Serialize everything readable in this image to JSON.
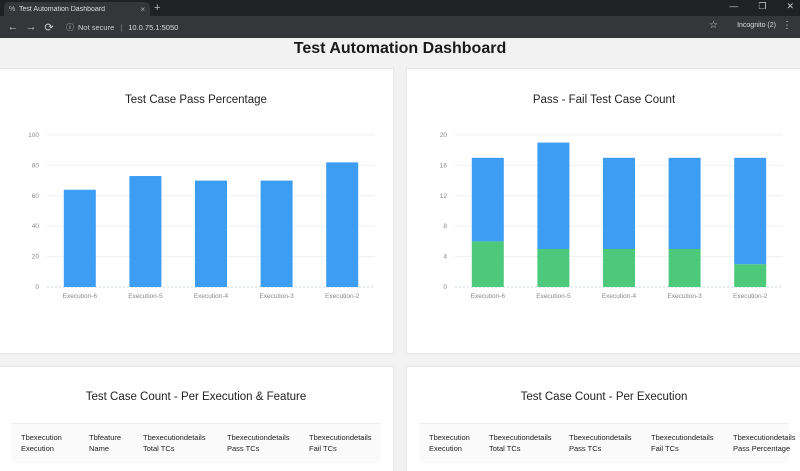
{
  "browser": {
    "tab_favicon": "%",
    "tab_title": "Test Automation Dashboard",
    "tab_close": "×",
    "new_tab": "+",
    "win_minimize": "—",
    "win_restore": "❐",
    "win_close": "✕",
    "back": "←",
    "forward": "→",
    "reload": "⟳",
    "info_icon": "ⓘ",
    "not_secure": "Not secure",
    "separator": "|",
    "url": "10.0.75.1:5050",
    "star": "☆",
    "incognito": "Incognito (2)",
    "menu": "⋮"
  },
  "page": {
    "title": "Test Automation Dashboard"
  },
  "cards": {
    "pass_percentage": {
      "title": "Test Case Pass Percentage"
    },
    "pass_fail": {
      "title": "Pass - Fail Test Case Count"
    },
    "per_execution_feature": {
      "title": "Test Case Count - Per Execution & Feature",
      "columns": [
        [
          "Tbexecution",
          "Execution"
        ],
        [
          "Tbfeature",
          "Name"
        ],
        [
          "Tbexecutiondetails",
          "Total TCs"
        ],
        [
          "Tbexecutiondetails",
          "Pass TCs"
        ],
        [
          "Tbexecutiondetails",
          "Fail TCs"
        ]
      ]
    },
    "per_execution": {
      "title": "Test Case Count - Per Execution",
      "columns": [
        [
          "Tbexecution",
          "Execution"
        ],
        [
          "Tbexecutiondetails",
          "Total TCs"
        ],
        [
          "Tbexecutiondetails",
          "Pass TCs"
        ],
        [
          "Tbexecutiondetails",
          "Fail TCs"
        ],
        [
          "Tbexecutiondetails",
          "Pass Percentage"
        ]
      ]
    }
  },
  "chart_data": [
    {
      "type": "bar",
      "title": "Test Case Pass Percentage",
      "categories": [
        "Execution-6",
        "Execution-5",
        "Execution-4",
        "Execution-3",
        "Execution-2"
      ],
      "values": [
        64,
        73,
        70,
        70,
        82
      ],
      "ylim": [
        0,
        100
      ],
      "yticks": [
        0,
        20,
        40,
        60,
        80,
        100
      ],
      "grid": true,
      "colors": [
        "#3d9df2"
      ]
    },
    {
      "type": "bar",
      "stacked": true,
      "title": "Pass - Fail Test Case Count",
      "categories": [
        "Execution-6",
        "Execution-5",
        "Execution-4",
        "Execution-3",
        "Execution-2"
      ],
      "series": [
        {
          "values": [
            6,
            5,
            5,
            5,
            3
          ]
        },
        {
          "values": [
            11,
            14,
            12,
            12,
            14
          ]
        }
      ],
      "ylim": [
        0,
        20
      ],
      "yticks": [
        0,
        4,
        8,
        12,
        16,
        20
      ],
      "grid": true,
      "colors": [
        "#4cc97a",
        "#3d9df2"
      ]
    }
  ]
}
